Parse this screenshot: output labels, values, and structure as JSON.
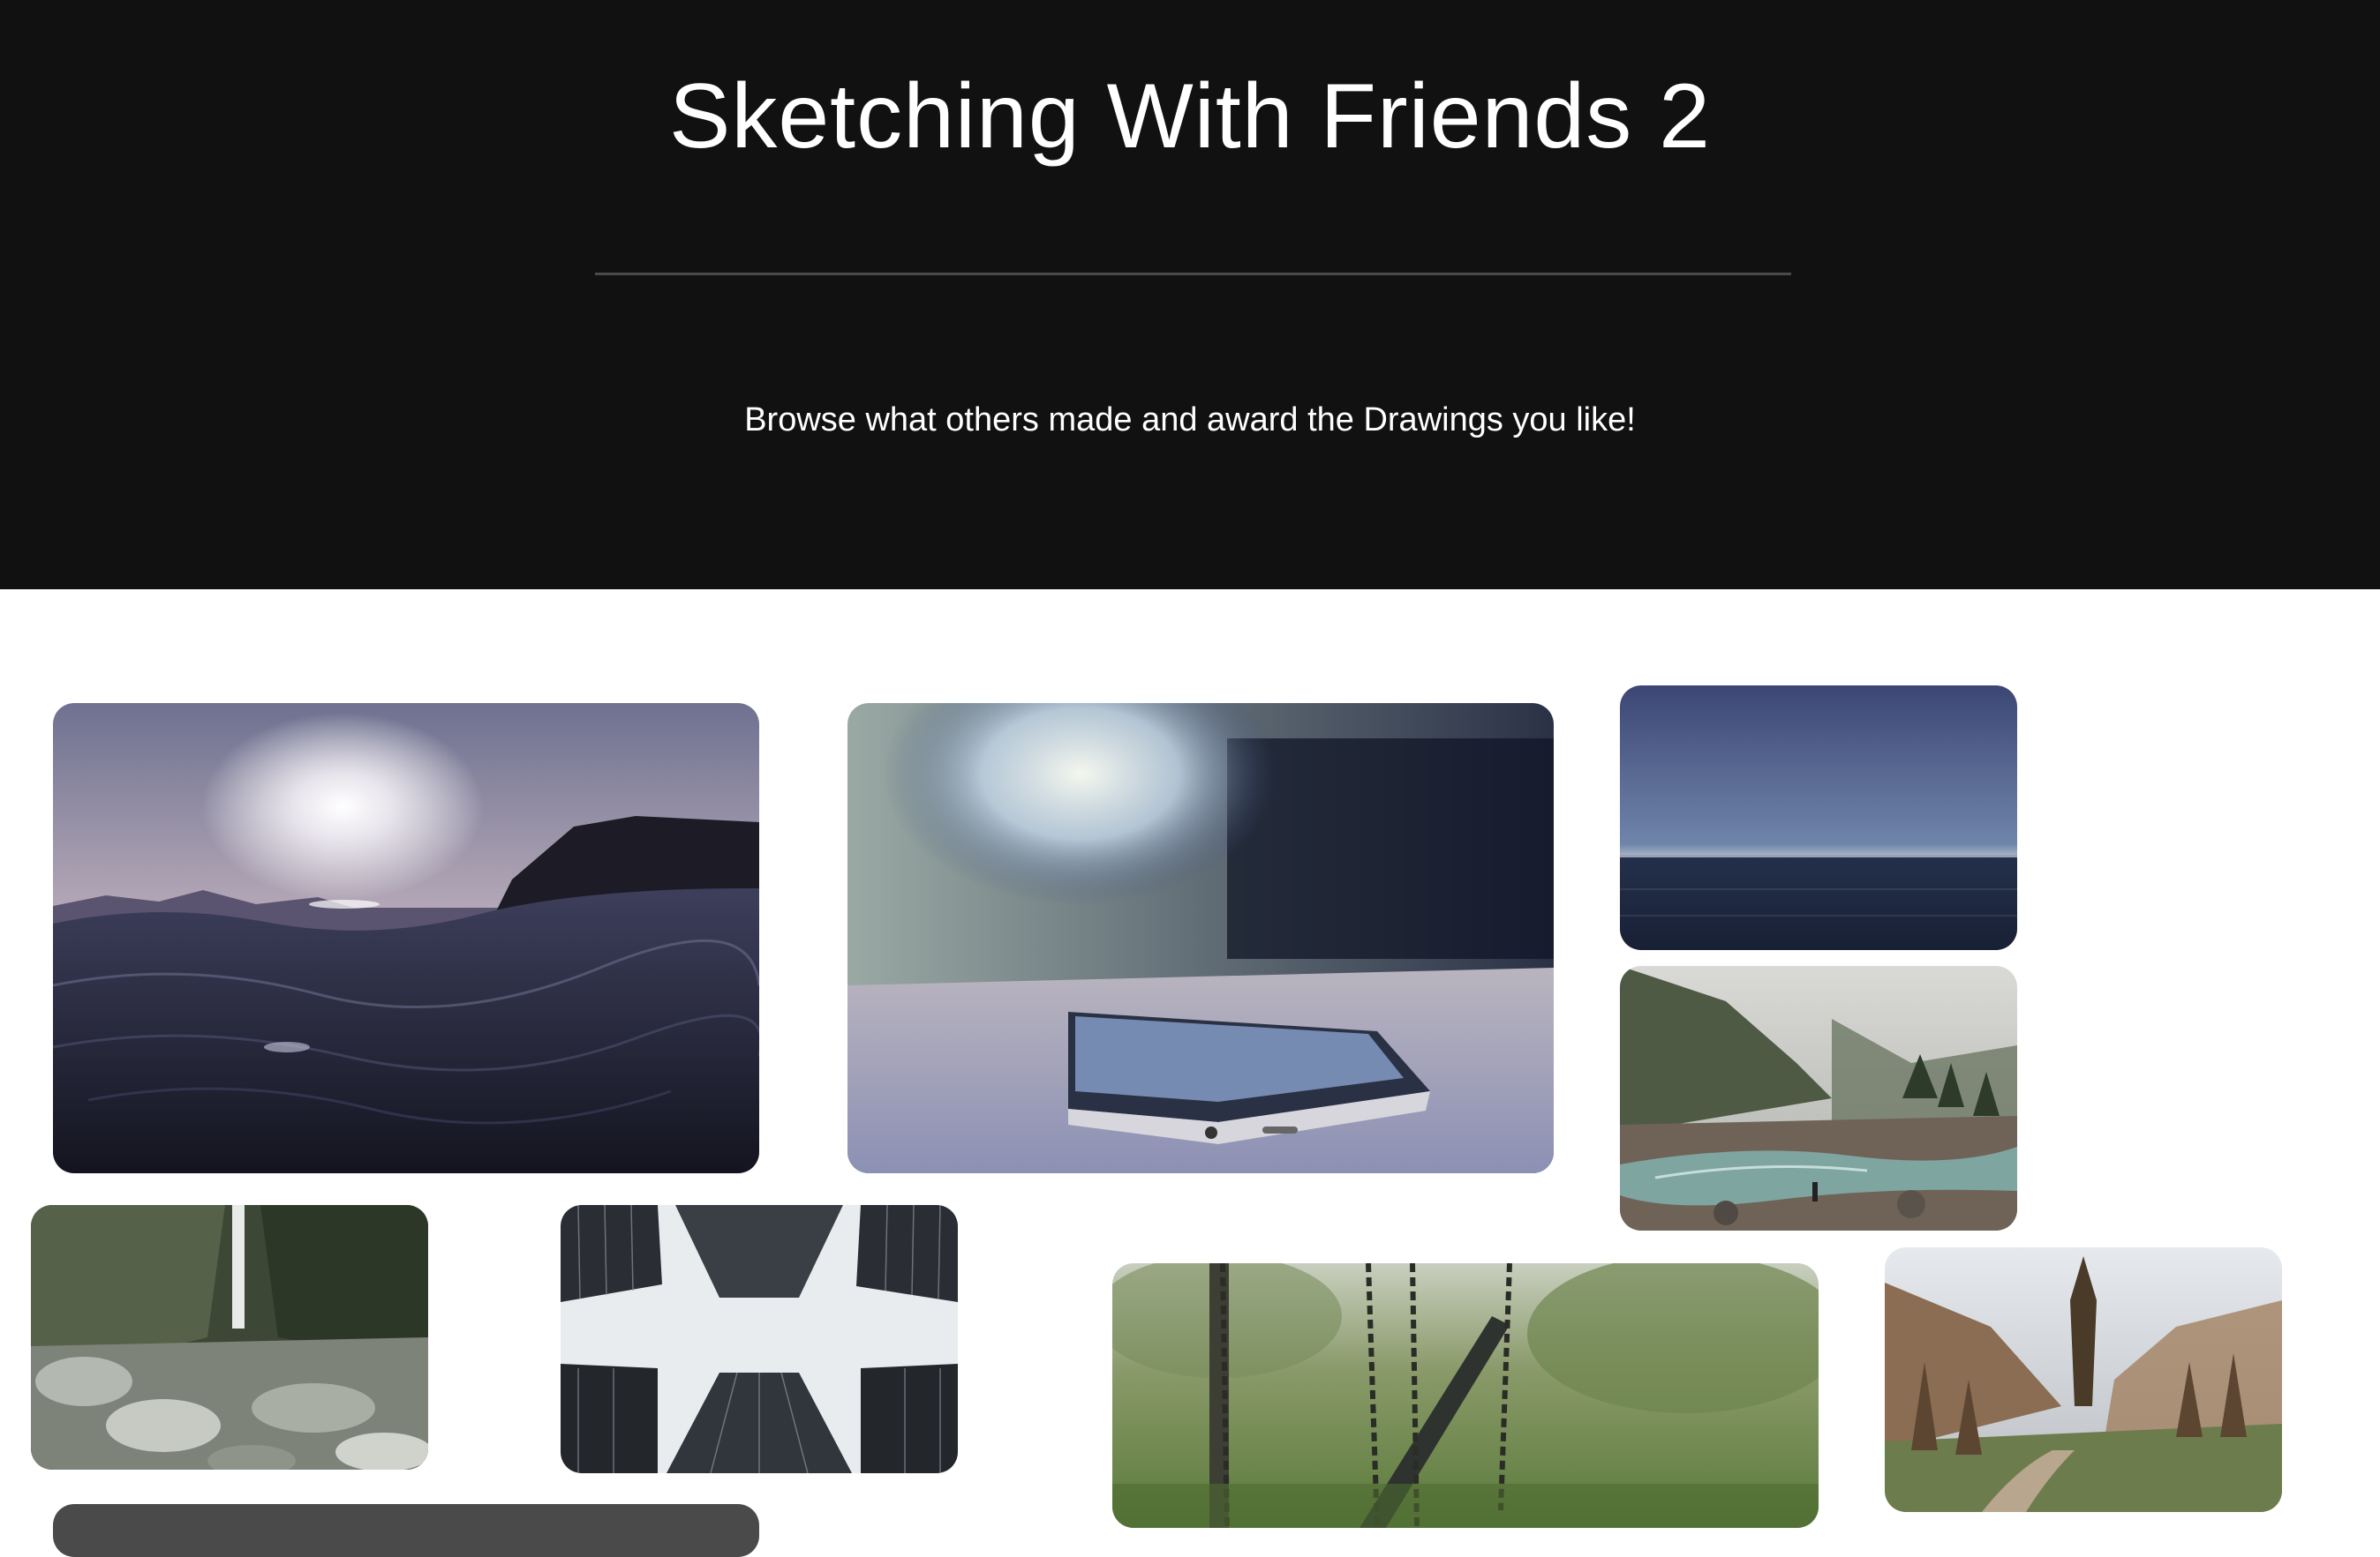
{
  "header": {
    "title": "Sketching With Friends 2",
    "subtitle": "Browse what others made and award the Drawings you like!"
  },
  "gallery": {
    "drawings": [
      {
        "subject": "ocean waves at sunset",
        "name": "drawing-ocean-waves"
      },
      {
        "subject": "smartphone on a table",
        "name": "drawing-smartphone"
      },
      {
        "subject": "calm sea horizon",
        "name": "drawing-sea-horizon"
      },
      {
        "subject": "river in a misty valley",
        "name": "drawing-river-valley"
      },
      {
        "subject": "waterfall in a rocky gorge",
        "name": "drawing-waterfall"
      },
      {
        "subject": "skyscrapers from below",
        "name": "drawing-skyscrapers"
      },
      {
        "subject": "playground swings",
        "name": "drawing-swings"
      },
      {
        "subject": "forest trail in fog",
        "name": "drawing-forest-trail"
      },
      {
        "subject": "dark image",
        "name": "drawing-partial-bottom"
      }
    ]
  },
  "colors": {
    "hero_background": "#111111",
    "divider": "#4a4a4a",
    "page_background": "#ffffff"
  }
}
